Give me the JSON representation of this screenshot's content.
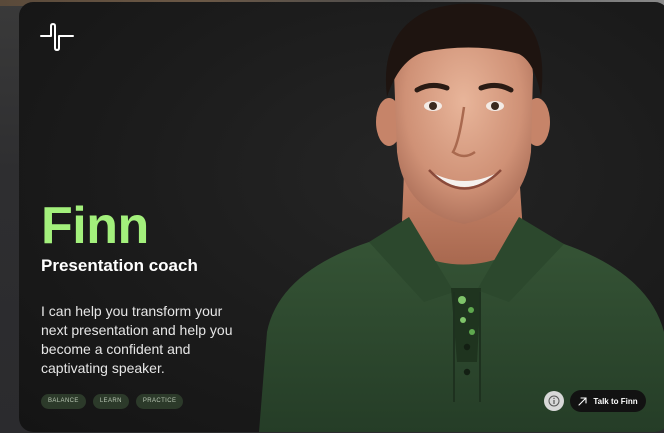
{
  "agent": {
    "name": "Finn",
    "role": "Presentation coach",
    "description": "I can help you transform your next presentation and help you become a confident and captivating speaker."
  },
  "tags": [
    "BALANCE",
    "LEARN",
    "PRACTICE"
  ],
  "actions": {
    "talk_label": "Talk to Finn"
  },
  "colors": {
    "accent": "#a3f07c",
    "card_bg": "#1b1b1b",
    "shirt": "#2f4a30"
  },
  "icons": {
    "logo": "pulse-logo-icon",
    "info": "info-icon",
    "arrow": "arrow-up-right-icon"
  }
}
